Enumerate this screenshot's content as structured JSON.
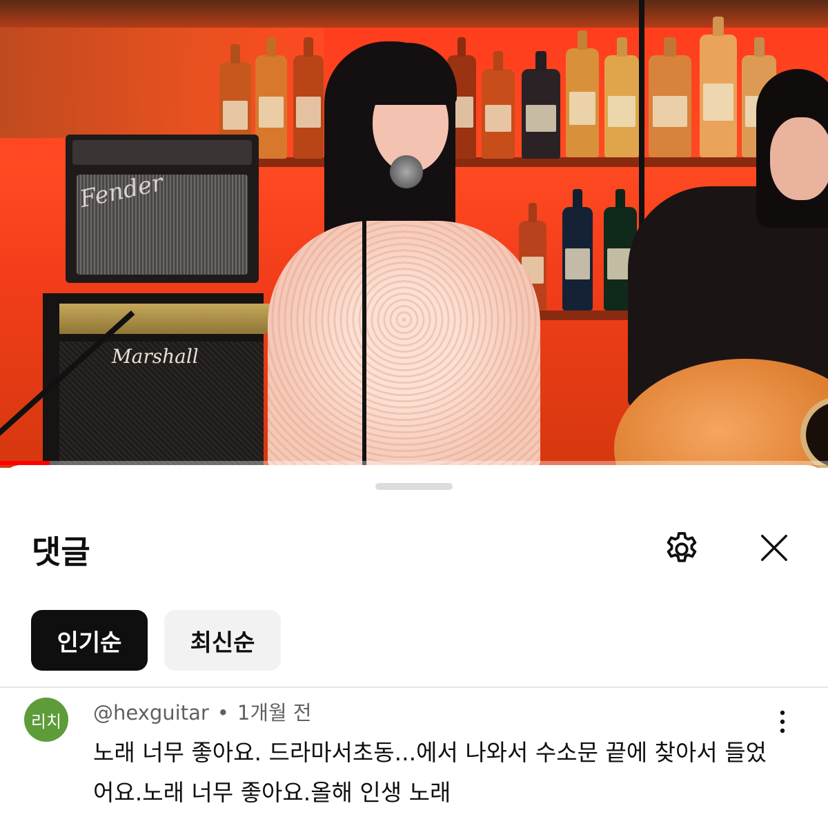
{
  "video": {
    "amp_brand_top": "Fender",
    "amp_brand_bottom": "Marshall",
    "progress_fraction": 0.06
  },
  "sheet": {
    "title": "댓글"
  },
  "sort_chips": [
    {
      "label": "인기순",
      "selected": true
    },
    {
      "label": "최신순",
      "selected": false
    }
  ],
  "comments": [
    {
      "avatar_text": "리치",
      "avatar_color": "#5e9c3a",
      "author": "@hexguitar",
      "separator": "•",
      "time": "1개월 전",
      "text": "노래 너무 좋아요. 드라마서초동...에서 나와서 수소문 끝에 찾아서 들었어요.노래 너무 좋아요.올해 인생 노래"
    }
  ],
  "icons": {
    "settings": "gear-icon",
    "close": "close-icon",
    "more": "more-vertical-icon"
  },
  "colors": {
    "accent_progress": "#ff0000",
    "chip_active_bg": "#0f0f0f",
    "chip_inactive_bg": "#f2f2f2"
  }
}
